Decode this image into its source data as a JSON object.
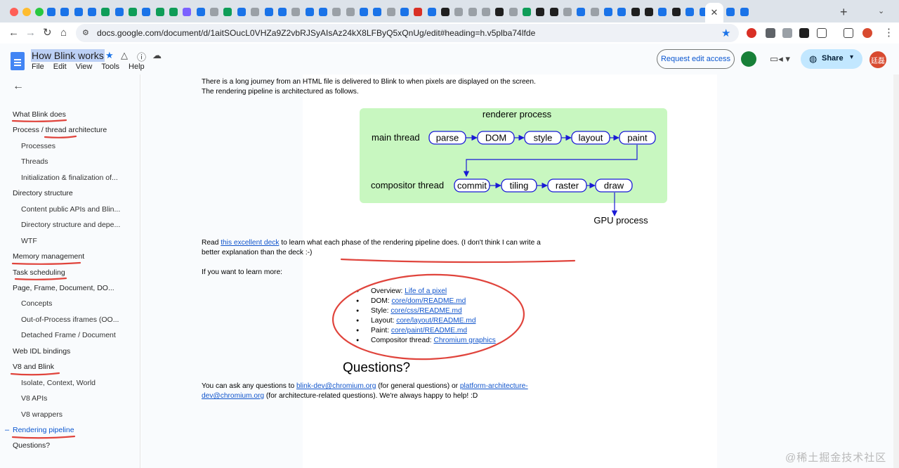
{
  "browser": {
    "url": "docs.google.com/document/d/1aitSOucL0VHZa9Z2vbRJSyAIsAz24kX8LFByQ5xQnUg/edit#heading=h.v5plba74lfde",
    "tab_close": "✕",
    "new_tab": "+",
    "tab_favicon_colors": [
      "#1a73e8",
      "#1a73e8",
      "#1a73e8",
      "#1a73e8",
      "#0f9d58",
      "#1a73e8",
      "#0f9d58",
      "#1a73e8",
      "#0f9d58",
      "#0f9d58",
      "#7b61ff",
      "#1a73e8",
      "#9aa0a6",
      "#0f9d58",
      "#1a73e8",
      "#9aa0a6",
      "#1a73e8",
      "#1a73e8",
      "#9aa0a6",
      "#1a73e8",
      "#1a73e8",
      "#9aa0a6",
      "#9aa0a6",
      "#1a73e8",
      "#1a73e8",
      "#9aa0a6",
      "#1a73e8",
      "#d93025",
      "#1a73e8",
      "#1f1f1f",
      "#9aa0a6",
      "#9aa0a6",
      "#9aa0a6",
      "#1f1f1f",
      "#9aa0a6",
      "#0f9d58",
      "#1f1f1f",
      "#1f1f1f",
      "#9aa0a6",
      "#1a73e8",
      "#9aa0a6",
      "#1a73e8",
      "#1a73e8",
      "#1f1f1f",
      "#1f1f1f",
      "#1a73e8",
      "#1f1f1f",
      "#1a73e8",
      "#1a73e8",
      "#9aa0a6",
      "#1a73e8",
      "#1a73e8"
    ]
  },
  "docs": {
    "title": "How Blink works",
    "menu": [
      "File",
      "Edit",
      "View",
      "Tools",
      "Help"
    ],
    "request_edit": "Request edit access",
    "share": "Share",
    "avatar_text": "廷磊"
  },
  "outline": {
    "items": [
      {
        "label": "What Blink does",
        "level": 1
      },
      {
        "label": "Process / thread architecture",
        "level": 1
      },
      {
        "label": "Processes",
        "level": 2
      },
      {
        "label": "Threads",
        "level": 2
      },
      {
        "label": "Initialization & finalization of...",
        "level": 2
      },
      {
        "label": "Directory structure",
        "level": 1
      },
      {
        "label": "Content public APIs and Blin...",
        "level": 2
      },
      {
        "label": "Directory structure and depe...",
        "level": 2
      },
      {
        "label": "WTF",
        "level": 2
      },
      {
        "label": "Memory management",
        "level": 1
      },
      {
        "label": "Task scheduling",
        "level": 1
      },
      {
        "label": "Page, Frame, Document, DO...",
        "level": 1
      },
      {
        "label": "Concepts",
        "level": 2
      },
      {
        "label": "Out-of-Process iframes (OO...",
        "level": 2
      },
      {
        "label": "Detached Frame / Document",
        "level": 2
      },
      {
        "label": "Web IDL bindings",
        "level": 1
      },
      {
        "label": "V8 and Blink",
        "level": 1
      },
      {
        "label": "Isolate, Context, World",
        "level": 2
      },
      {
        "label": "V8 APIs",
        "level": 2
      },
      {
        "label": "V8 wrappers",
        "level": 2
      },
      {
        "label": "Rendering pipeline",
        "level": 1
      },
      {
        "label": "Questions?",
        "level": 1
      }
    ]
  },
  "content": {
    "intro": "There is a long journey from an HTML file is delivered to Blink to when pixels are displayed on the screen. The rendering pipeline is architectured as follows.",
    "diagram": {
      "title": "renderer process",
      "main_thread": "main thread",
      "compositor_thread": "compositor thread",
      "main_steps": [
        "parse",
        "DOM",
        "style",
        "layout",
        "paint"
      ],
      "compositor_steps": [
        "commit",
        "tiling",
        "raster",
        "draw"
      ],
      "gpu": "GPU process"
    },
    "read_pre": "Read ",
    "read_link": "this excellent deck",
    "read_post": " to learn what each phase of the rendering pipeline does. (I don't think I can write a better explanation than the deck :-)",
    "learn_more": "If you want to learn more:",
    "bullets": [
      {
        "label": "Overview: ",
        "link": "Life of a pixel"
      },
      {
        "label": "DOM: ",
        "link": "core/dom/README.md"
      },
      {
        "label": "Style: ",
        "link": "core/css/README.md"
      },
      {
        "label": "Layout: ",
        "link": "core/layout/README.md"
      },
      {
        "label": "Paint: ",
        "link": "core/paint/README.md"
      },
      {
        "label": "Compositor thread: ",
        "link": "Chromium graphics"
      }
    ],
    "questions_heading": "Questions?",
    "q_pre": "You can ask any questions to ",
    "q_link1": "blink-dev@chromium.org",
    "q_mid": " (for general questions) or ",
    "q_link2": "platform-architecture-dev@chromium.org",
    "q_post": " (for architecture-related questions). We're always happy to help! :D"
  },
  "watermark": "@稀土掘金技术社区",
  "colors": {
    "annotation_red": "#e0443c",
    "diagram_green": "#c8f7c0",
    "diagram_blue": "#1a1ad6",
    "link_blue": "#1155cc",
    "accent": "#0b57d0"
  }
}
